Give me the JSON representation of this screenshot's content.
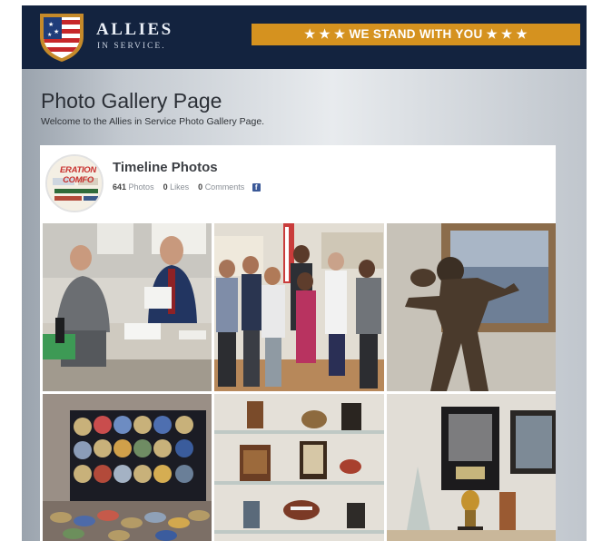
{
  "brand": {
    "title": "ALLIES",
    "subtitle": "IN SERVICE."
  },
  "banner": {
    "text": "★ ★ ★ WE STAND WITH YOU ★ ★ ★"
  },
  "page": {
    "title": "Photo Gallery Page",
    "welcome": "Welcome to the Allies in Service Photo Gallery Page."
  },
  "album": {
    "avatar_text": "ERATION COMFO",
    "title": "Timeline Photos",
    "photos_count": "641",
    "photos_label": "Photos",
    "likes_count": "0",
    "likes_label": "Likes",
    "comments_count": "0",
    "comments_label": "Comments",
    "facebook_icon": "f"
  },
  "photos": [
    {
      "name": "photo-meeting"
    },
    {
      "name": "photo-group"
    },
    {
      "name": "photo-statue"
    },
    {
      "name": "photo-coins"
    },
    {
      "name": "photo-shelves"
    },
    {
      "name": "photo-frames"
    }
  ],
  "colors": {
    "header_bg": "#13233f",
    "banner_bg": "#d5921f",
    "facebook": "#3b5998"
  }
}
